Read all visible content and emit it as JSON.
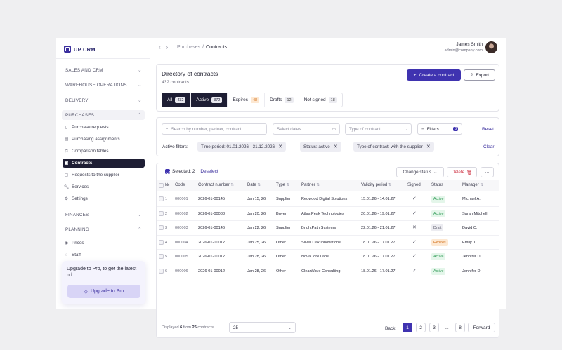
{
  "brand": {
    "logo_text": "UP CRM",
    "accent": "#3f33b0",
    "dark": "#1e1e34"
  },
  "sidebar": {
    "sections": {
      "sales": "SALES AND CRM",
      "warehouse": "WAREHOUSE OPERATIONS",
      "delivery": "DELIVERY",
      "purchases": "PURCHASES",
      "finances": "FINANCES",
      "planning": "PLANNING"
    },
    "purchases_items": [
      "Purchase requests",
      "Purchasing assignments",
      "Comparison tables",
      "Contracts",
      "Requests to the supplier",
      "Services",
      "Settings"
    ],
    "planning_items": [
      "Prices",
      "Staff"
    ],
    "promo": {
      "text": "Upgrade to Pro, to get the latest nd",
      "button": "Upgrade to Pro"
    }
  },
  "header": {
    "breadcrumb": [
      "Purchases",
      "Contracts"
    ],
    "separator": "/",
    "user": {
      "name": "James Smith",
      "email": "admin@company.com"
    }
  },
  "directory": {
    "title": "Directory of contracts",
    "count_text": "432 contracts",
    "create_button": "Create a contract",
    "export_button": "Export",
    "tabs": [
      {
        "label": "All",
        "count": "432"
      },
      {
        "label": "Active",
        "count": "372"
      },
      {
        "label": "Expires",
        "count": "48"
      },
      {
        "label": "Drafts",
        "count": "12"
      },
      {
        "label": "Not signed",
        "count": "18"
      }
    ]
  },
  "filters": {
    "search_placeholder": "Search by number, partner, contract",
    "dates_placeholder": "Select dates",
    "type_placeholder": "Type of contract",
    "filters_button": "Filters",
    "filters_count": "3",
    "reset": "Reset",
    "clear": "Clear",
    "active_label": "Active filters:",
    "chips": [
      "Time period:  01.01.2026 - 31.12.2026",
      "Status:  active",
      "Type of contract:  with the supplier"
    ]
  },
  "table": {
    "selected_label": "Selected:",
    "selected_count": "2",
    "deselect": "Deselect",
    "change_status": "Change status",
    "delete": "Delete",
    "more": "···",
    "columns": [
      "№",
      "Code",
      "Contract number",
      "Date",
      "Type",
      "Partner",
      "Validity period",
      "Signed",
      "Status",
      "Manager"
    ],
    "rows": [
      {
        "n": "1",
        "code": "000001",
        "number": "2026-01-00145",
        "date": "Jan 15, 26",
        "type": "Supplier",
        "partner": "Redwood Digital Solutions",
        "validity": "15.01.26 - 14.01.27",
        "signed": "✓",
        "status": "Active",
        "manager": "Michael A."
      },
      {
        "n": "2",
        "code": "000002",
        "number": "2026-01-00088",
        "date": "Jan 20, 26",
        "type": "Buyer",
        "partner": "Atlas Peak Technologies",
        "validity": "20.01.26 - 19.01.27",
        "signed": "✓",
        "status": "Active",
        "manager": "Sarah Mitchell"
      },
      {
        "n": "3",
        "code": "000003",
        "number": "2026-01-00146",
        "date": "Jan 22, 26",
        "type": "Supplier",
        "partner": "BrightPath Systems",
        "validity": "22.01.26 - 21.01.27",
        "signed": "✕",
        "status": "Draft",
        "manager": "David C."
      },
      {
        "n": "4",
        "code": "000004",
        "number": "2026-01-00012",
        "date": "Jan 25, 26",
        "type": "Other",
        "partner": "Silver Oak Innovations",
        "validity": "18.01.26 - 17.01.27",
        "signed": "✓",
        "status": "Expires",
        "manager": "Emily J."
      },
      {
        "n": "5",
        "code": "000005",
        "number": "2026-01-00012",
        "date": "Jan 28, 26",
        "type": "Other",
        "partner": "NovaCore Labs",
        "validity": "18.01.26 - 17.01.27",
        "signed": "✓",
        "status": "Active",
        "manager": "Jennifer D."
      },
      {
        "n": "6",
        "code": "000006",
        "number": "2026-01-00012",
        "date": "Jan 28, 26",
        "type": "Other",
        "partner": "ClearWave Consulting",
        "validity": "18.01.26 - 17.01.27",
        "signed": "✓",
        "status": "Active",
        "manager": "Jennifer D."
      }
    ],
    "footer": {
      "displayed": "Displayed",
      "shown": "6",
      "from": "from",
      "total": "26",
      "contracts": "contracts",
      "page_size": "25",
      "back": "Back",
      "pages": [
        "1",
        "2",
        "3",
        "...",
        "8"
      ],
      "forward": "Forward"
    }
  }
}
